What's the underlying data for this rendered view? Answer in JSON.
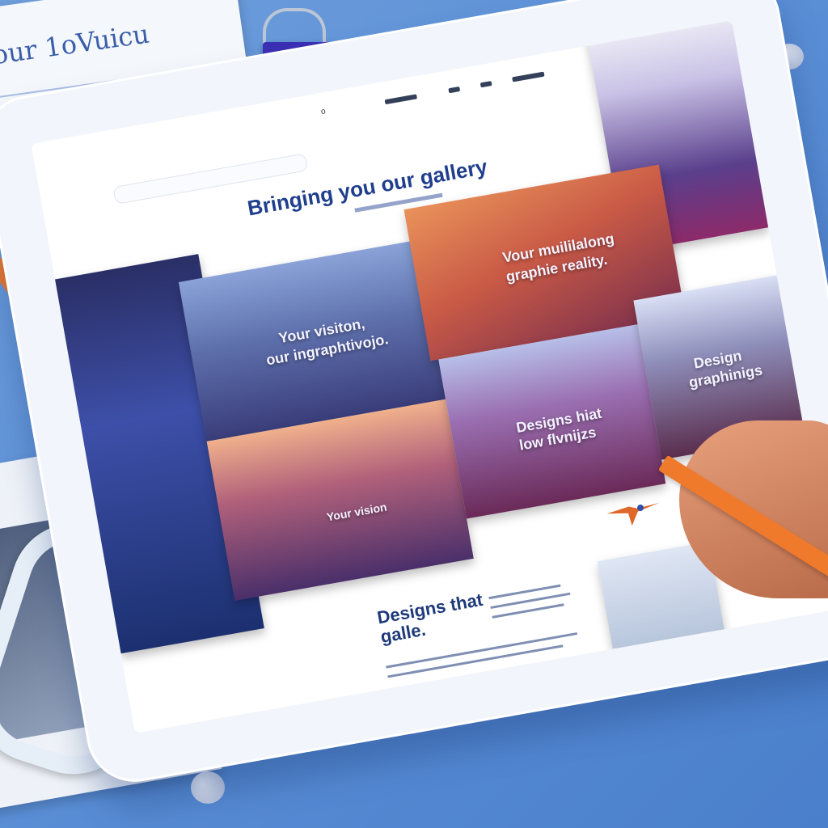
{
  "scene": {
    "paper_top_left_text": "our 1oVuicu",
    "tablet": {
      "nav": {
        "items": [
          "",
          "",
          "",
          "",
          ""
        ],
        "center_marker": "o"
      },
      "hero": {
        "title": "Bringing you our gallery"
      },
      "tiles": [
        {
          "caption_line1": "Your visiton,",
          "caption_line2": "our ingraphtivojo."
        },
        {
          "caption_line1": "Vour muililalong",
          "caption_line2": "graphie reality."
        },
        {
          "caption_line1": "Your vision",
          "caption_line2": ""
        },
        {
          "caption_line1": "Designs hiat",
          "caption_line2": "low flvnijzs"
        },
        {
          "caption_line1": "Design",
          "caption_line2": "graphinigs"
        }
      ],
      "bottom": {
        "title_line1": "Designs that",
        "title_line2": "galle."
      }
    }
  },
  "colors": {
    "background": "#5b8fd6",
    "accent_orange": "#f07a2b",
    "title_blue": "#1f3f8d"
  }
}
